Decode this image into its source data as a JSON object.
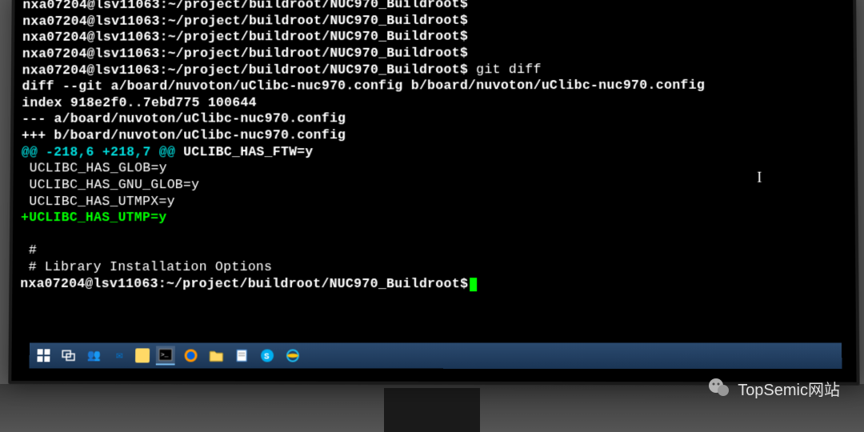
{
  "terminal": {
    "prompt_user": "nxa07204@lsv11063",
    "prompt_path": "~/project/buildroot/NUC970_Buildroot",
    "prompt_dollar": "$",
    "blank_lines_count": 4,
    "command": "git diff",
    "diff_header": "diff --git a/board/nuvoton/uClibc-nuc970.config b/board/nuvoton/uClibc-nuc970.config",
    "diff_index": "index 918e2f0..7ebd775 100644",
    "diff_minus": "--- a/board/nuvoton/uClibc-nuc970.config",
    "diff_plus": "+++ b/board/nuvoton/uClibc-nuc970.config",
    "hunk_marker": "@@ -218,6 +218,7 @@",
    "hunk_context": " UCLIBC_HAS_FTW=y",
    "ctx1": " UCLIBC_HAS_GLOB=y",
    "ctx2": " UCLIBC_HAS_GNU_GLOB=y",
    "ctx3": " UCLIBC_HAS_UTMPX=y",
    "added1": "+UCLIBC_HAS_UTMP=y",
    "comment_hash": " #",
    "comment_text": " # Library Installation Options"
  },
  "taskbar": {
    "items": [
      {
        "name": "start-icon",
        "glyph": "⊞"
      },
      {
        "name": "task-view-icon",
        "glyph": "▭"
      },
      {
        "name": "teams-icon",
        "glyph": "👥"
      },
      {
        "name": "mail-icon",
        "glyph": "✉"
      },
      {
        "name": "sticky-icon",
        "glyph": "🗒"
      },
      {
        "name": "terminal-icon",
        "glyph": "▮",
        "active": true
      },
      {
        "name": "firefox-icon",
        "glyph": "🦊"
      },
      {
        "name": "explorer-icon",
        "glyph": "📁"
      },
      {
        "name": "notepad-icon",
        "glyph": "📝"
      },
      {
        "name": "skype-icon",
        "glyph": "S"
      },
      {
        "name": "ie-icon",
        "glyph": "e"
      }
    ]
  },
  "watermark": {
    "text": "TopSemic网站"
  }
}
